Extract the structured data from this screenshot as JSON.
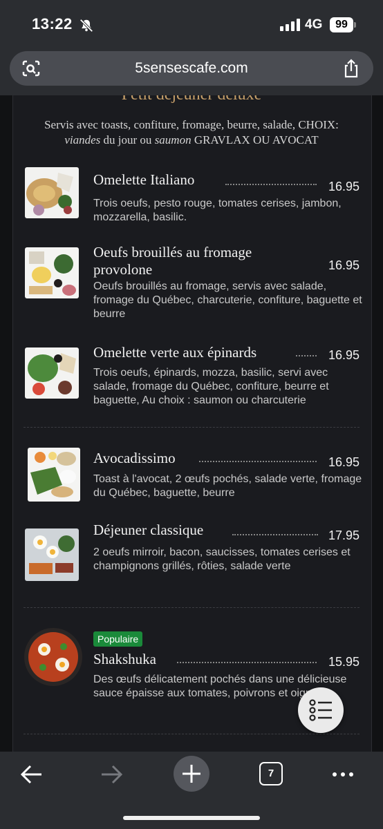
{
  "status_bar": {
    "time": "13:22",
    "network": "4G",
    "battery": "99"
  },
  "browser": {
    "url": "5sensescafe.com",
    "tab_count": "7"
  },
  "section": {
    "title": "Petit déjeuner deluxe",
    "subtitle_line1": "Servis avec toasts, confiture, fromage, beurre, salade, CHOIX:",
    "subtitle_viandes": "viandes",
    "subtitle_mid": " du jour ou ",
    "subtitle_saumon": "saumon",
    "subtitle_end": " GRAVLAX OU AVOCAT"
  },
  "items": [
    {
      "name": "Omelette Italiano",
      "price": "16.95",
      "desc": "Trois oeufs, pesto rouge, tomates cerises, jambon, mozzarella, basilic."
    },
    {
      "name": "Oeufs brouillés au fromage provolone",
      "price": "16.95",
      "desc": "Oeufs brouillés au fromage, servis avec salade, fromage du Québec, charcuterie, confiture, baguette et beurre"
    },
    {
      "name": "Omelette verte aux épinards",
      "price": "16.95",
      "desc": "Trois oeufs, épinards, mozza, basilic, servi avec salade, fromage du Québec, confiture, beurre et baguette, Au choix : saumon ou charcuterie"
    },
    {
      "name": "Avocadissimo",
      "price": "16.95",
      "desc": "Toast à l'avocat, 2 œufs pochés, salade verte, fromage du Québec, baguette, beurre"
    },
    {
      "name": "Déjeuner classique",
      "price": "17.95",
      "desc": "2 oeufs mirroir, bacon, saucisses, tomates cerises et champignons grillés, rôties, salade verte"
    },
    {
      "name": "Shakshuka",
      "price": "15.95",
      "badge": "Populaire",
      "desc": "Des œufs délicatement pochés dans une délicieuse sauce épaisse aux tomates, poivrons et oignons."
    }
  ]
}
